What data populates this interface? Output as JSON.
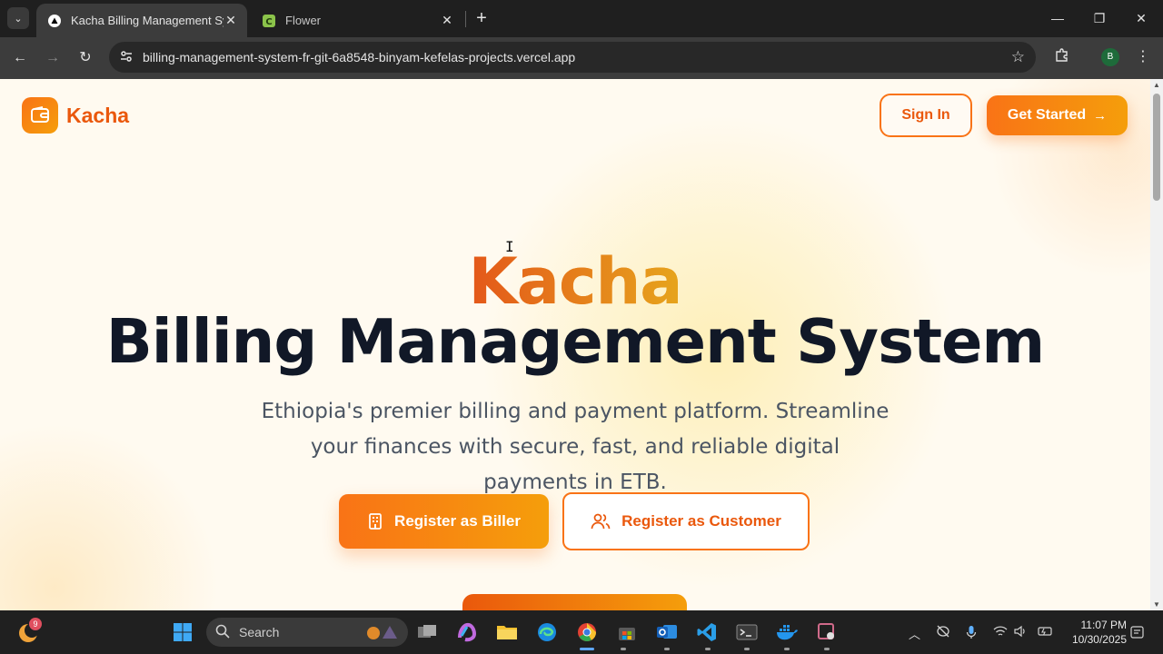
{
  "browser": {
    "tabs": [
      {
        "title": "Kacha Billing Management System",
        "active": true
      },
      {
        "title": "Flower",
        "active": false
      }
    ],
    "url": "billing-management-system-fr-git-6a8548-binyam-kefelas-projects.vercel.app",
    "profile_initial": "B"
  },
  "page": {
    "logo_text": "Kacha",
    "nav": {
      "sign_in": "Sign In",
      "get_started": "Get Started"
    },
    "hero": {
      "brand": "Kacha",
      "title": "Billing Management System",
      "subtitle": "Ethiopia's premier billing and payment platform. Streamline your finances with secure, fast, and reliable digital payments in ETB."
    },
    "cta": {
      "biller": "Register as Biller",
      "customer": "Register as Customer"
    },
    "colors": {
      "accent": "#f97316",
      "accent_end": "#f59e0b",
      "title": "#111827"
    }
  },
  "taskbar": {
    "search_label": "Search",
    "weather_badge": "9",
    "time": "11:07 PM",
    "date": "10/30/2025"
  }
}
